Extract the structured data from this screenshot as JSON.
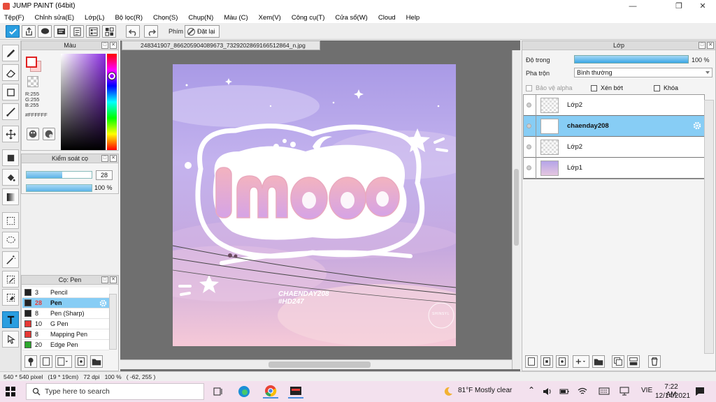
{
  "window": {
    "title": "JUMP PAINT (64bit)"
  },
  "menu": [
    "Tệp(F)",
    "Chỉnh sửa(E)",
    "Lớp(L)",
    "Bộ lọc(R)",
    "Chọn(S)",
    "Chụp(N)",
    "Màu (C)",
    "Xem(V)",
    "Công cụ(T)",
    "Cửa sổ(W)",
    "Cloud",
    "Help"
  ],
  "toolbar": {
    "keys_label": "Phím",
    "reset_label": "Đặt lại"
  },
  "color_panel": {
    "title": "Màu",
    "r": "R:255",
    "g": "G:255",
    "b": "B:255",
    "hex": "#FFFFFF",
    "fg_color": "#ffffff",
    "bg_color": "#ffd1d1"
  },
  "brush_control": {
    "title": "Kiểm soát cọ",
    "size_value": "28",
    "opacity_label": "100 %",
    "size_fraction": 0.55,
    "opacity_fraction": 1.0
  },
  "brush_panel": {
    "title": "Cọ: Pen",
    "brushes": [
      {
        "size": "3",
        "name": "Pencil",
        "color": "#222222"
      },
      {
        "size": "28",
        "name": "Pen",
        "color": "#222222",
        "selected": true
      },
      {
        "size": "8",
        "name": "Pen (Sharp)",
        "color": "#222222"
      },
      {
        "size": "10",
        "name": "G Pen",
        "color": "#e53935"
      },
      {
        "size": "8",
        "name": "Mapping Pen",
        "color": "#e53935"
      },
      {
        "size": "20",
        "name": "Edge Pen",
        "color": "#2ea82e"
      }
    ]
  },
  "document": {
    "tab_name": "248341907_866205904089673_7329202869166512864_n.jpg",
    "art_text_1": "CHAENDAY208",
    "art_text_2": "#HD247",
    "art_stamp": "SHINSYL"
  },
  "layer_panel": {
    "title": "Lớp",
    "opacity_label": "Độ trong",
    "opacity_value": "100 %",
    "blend_label": "Pha trộn",
    "blend_value": "Bình thường",
    "protect_alpha": "Bảo vệ alpha",
    "clipping": "Xén bớt",
    "lock": "Khóa",
    "layers": [
      {
        "name": "Lớp2",
        "selected": false,
        "thumb": "empty"
      },
      {
        "name": "chaenday208",
        "selected": true,
        "thumb": "text"
      },
      {
        "name": "Lớp2",
        "selected": false,
        "thumb": "empty"
      },
      {
        "name": "Lớp1",
        "selected": false,
        "thumb": "image"
      }
    ]
  },
  "status": {
    "text": "540 * 540 pixel   (19 * 19cm)   72 dpi   100 %   ( -62, 255 )"
  },
  "taskbar": {
    "search_placeholder": "Type here to search",
    "weather": "81°F  Mostly clear",
    "lang": "VIE",
    "time": "7:22 AM",
    "date": "12/14/2021"
  }
}
